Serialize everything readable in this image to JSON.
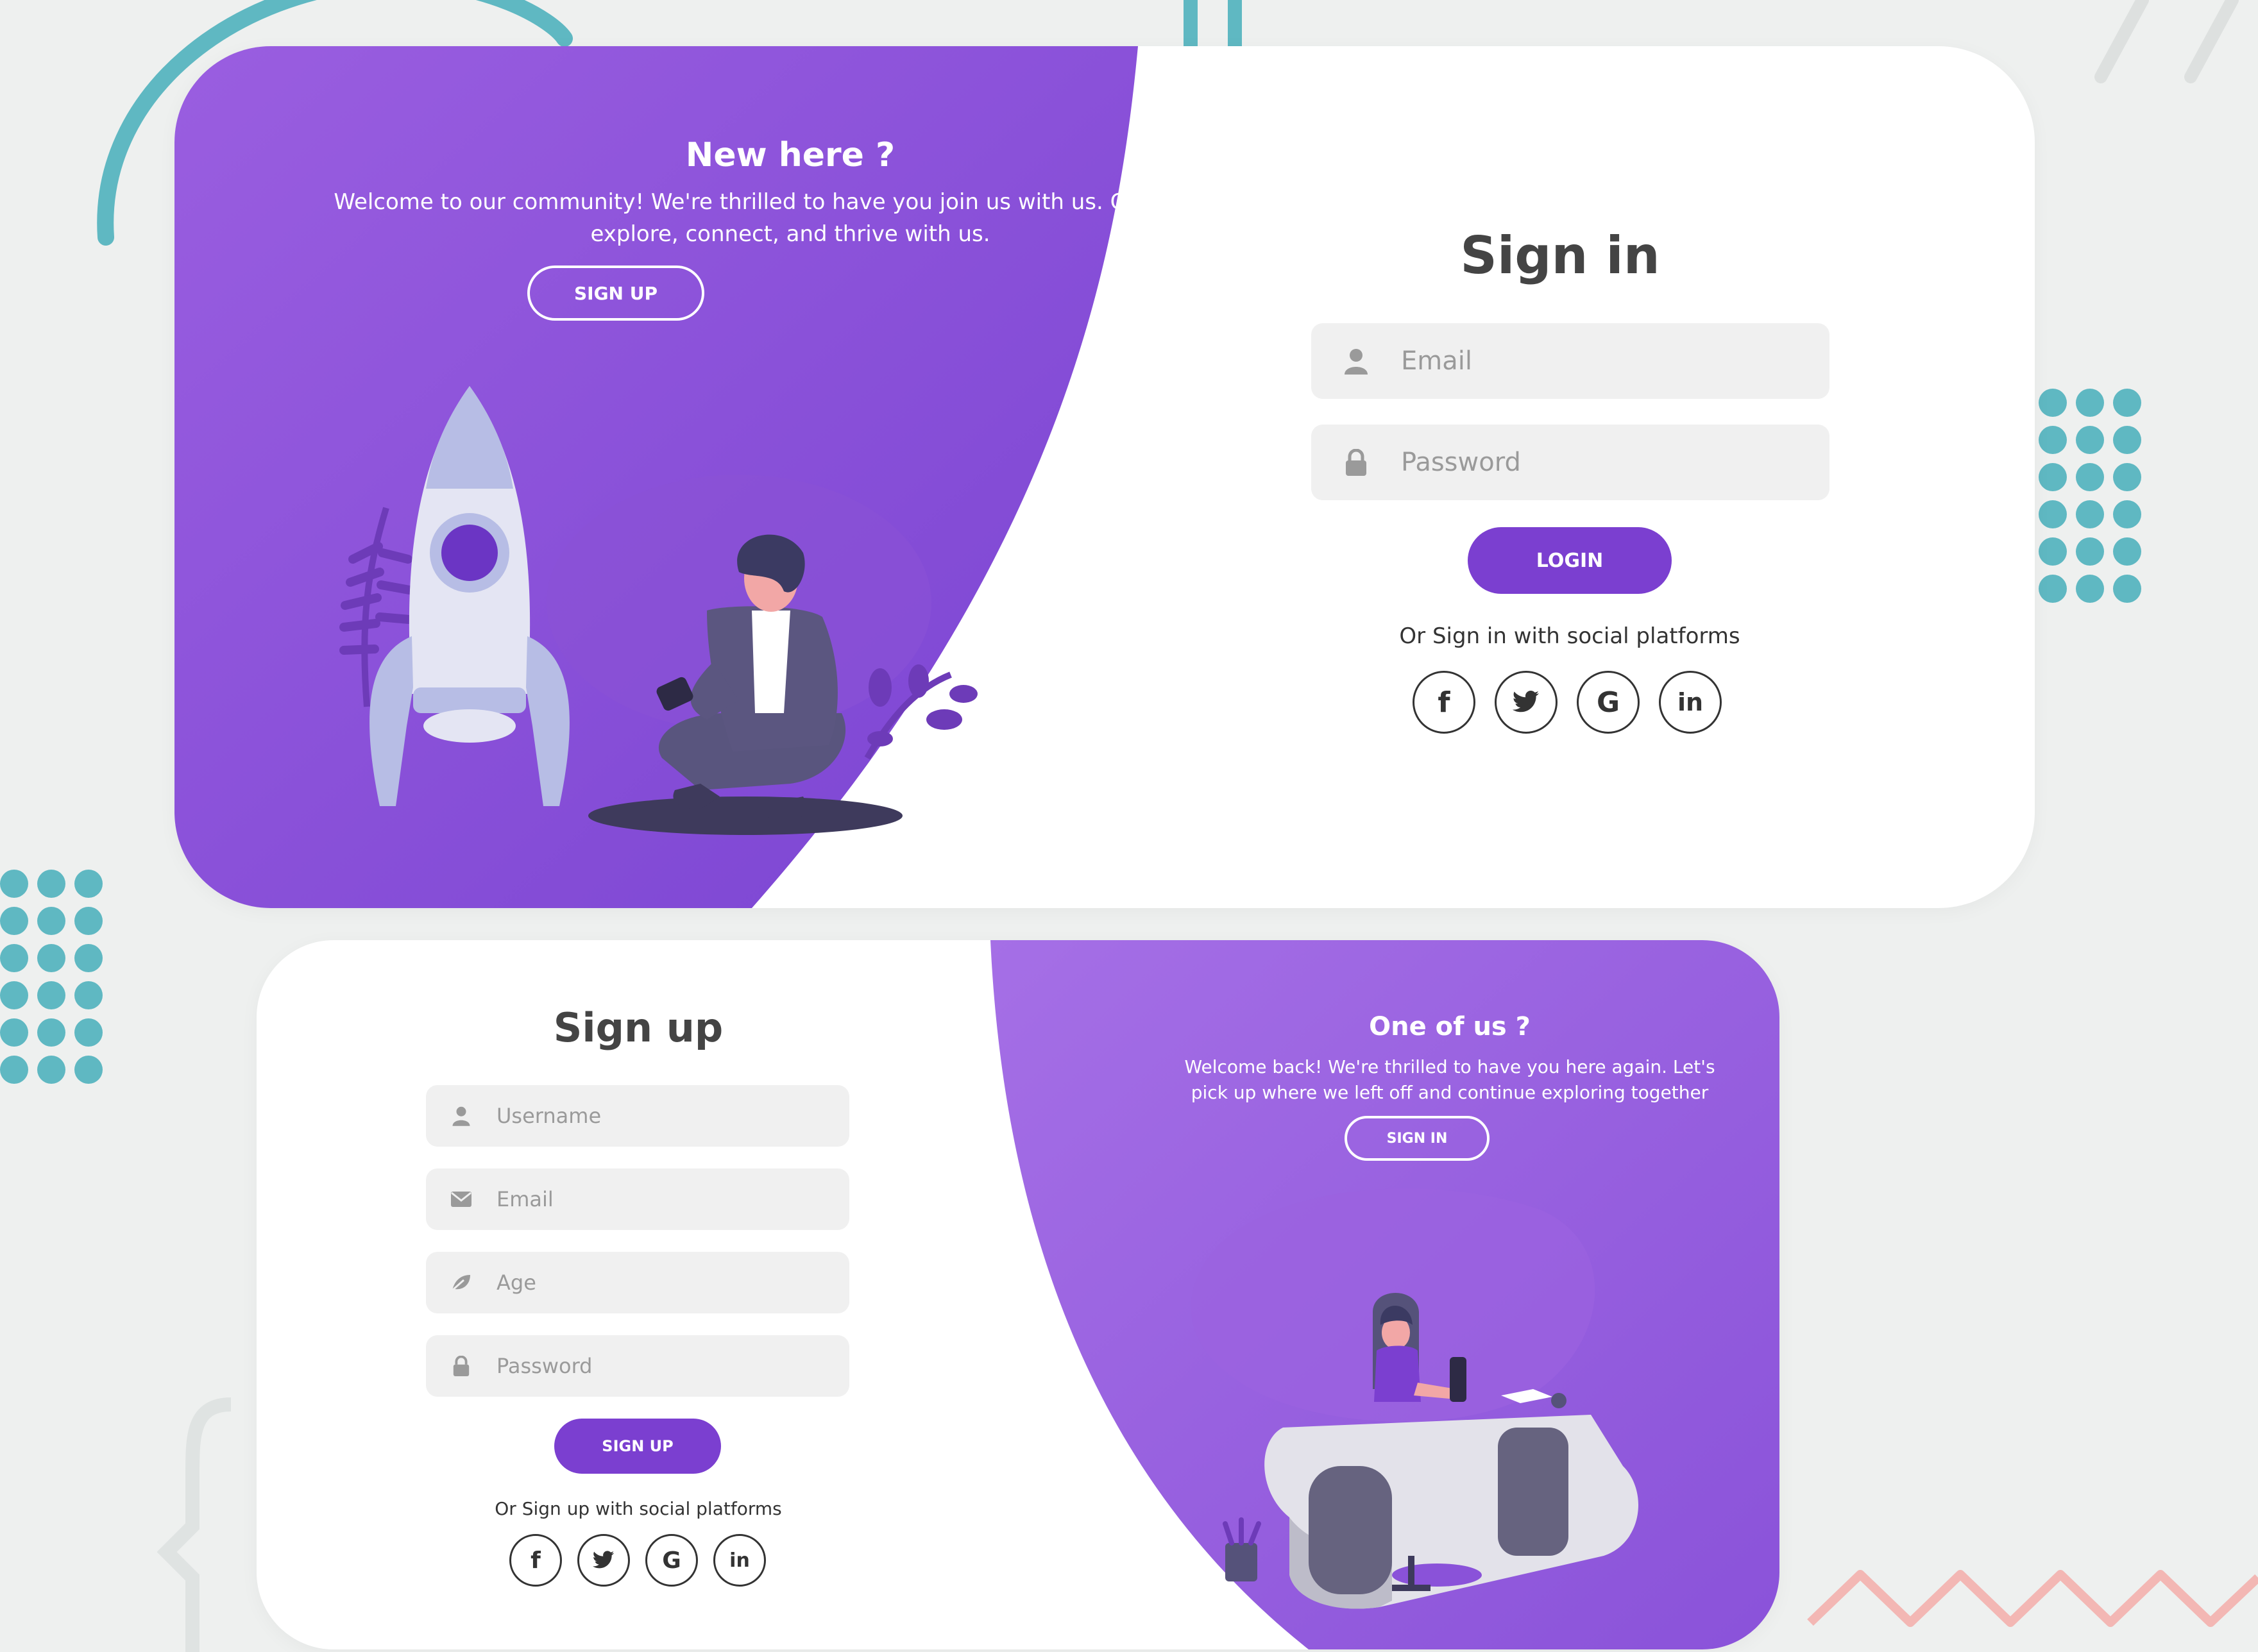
{
  "colors": {
    "accent": "#7b3fd0",
    "panel_gradient_start": "#9a5ee0",
    "panel_gradient_end": "#7a44d2",
    "background": "#eef0ef",
    "teal_decoration": "#5fb8c2",
    "pink_decoration": "#f3b7b4"
  },
  "signin_card": {
    "panel": {
      "title": "New here ?",
      "text": "Welcome to our community! We're thrilled to have you join us with us. Get ready to explore, connect, and thrive with us.",
      "button_label": "SIGN UP"
    },
    "form": {
      "title": "Sign in",
      "fields": [
        {
          "icon": "user-icon",
          "placeholder": "Email",
          "value": ""
        },
        {
          "icon": "lock-icon",
          "placeholder": "Password",
          "value": ""
        }
      ],
      "submit_label": "LOGIN",
      "social_text": "Or Sign in with social platforms",
      "socials": [
        {
          "icon": "facebook-icon",
          "glyph": "f"
        },
        {
          "icon": "twitter-icon",
          "glyph": ""
        },
        {
          "icon": "google-icon",
          "glyph": "G"
        },
        {
          "icon": "linkedin-icon",
          "glyph": "in"
        }
      ]
    }
  },
  "signup_card": {
    "panel": {
      "title": "One of us ?",
      "text": "Welcome back! We're thrilled to have you here again. Let's pick up where we left off and continue exploring together",
      "button_label": "SIGN IN"
    },
    "form": {
      "title": "Sign up",
      "fields": [
        {
          "icon": "user-icon",
          "placeholder": "Username",
          "value": ""
        },
        {
          "icon": "envelope-icon",
          "placeholder": "Email",
          "value": ""
        },
        {
          "icon": "leaf-icon",
          "placeholder": "Age",
          "value": ""
        },
        {
          "icon": "lock-icon",
          "placeholder": "Password",
          "value": ""
        }
      ],
      "submit_label": "SIGN UP",
      "social_text": "Or Sign up with social platforms",
      "socials": [
        {
          "icon": "facebook-icon",
          "glyph": "f"
        },
        {
          "icon": "twitter-icon",
          "glyph": ""
        },
        {
          "icon": "google-icon",
          "glyph": "G"
        },
        {
          "icon": "linkedin-icon",
          "glyph": "in"
        }
      ]
    }
  }
}
